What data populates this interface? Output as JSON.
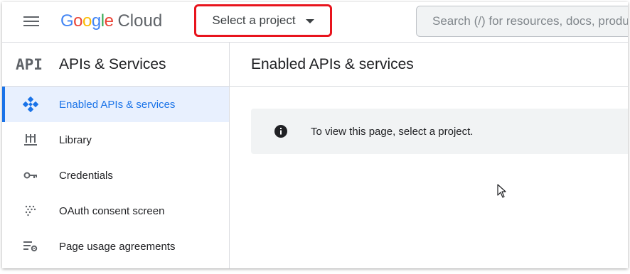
{
  "topbar": {
    "logo_google": [
      "G",
      "o",
      "o",
      "g",
      "l",
      "e"
    ],
    "logo_product": "Cloud",
    "project_picker_label": "Select a project",
    "search_placeholder": "Search (/) for resources, docs, products, and more"
  },
  "sidebar": {
    "section_mark": "API",
    "title": "APIs & Services",
    "items": [
      {
        "label": "Enabled APIs & services",
        "icon": "api-diamond-icon",
        "active": true
      },
      {
        "label": "Library",
        "icon": "library-icon",
        "active": false
      },
      {
        "label": "Credentials",
        "icon": "key-icon",
        "active": false
      },
      {
        "label": "OAuth consent screen",
        "icon": "consent-dots-icon",
        "active": false
      },
      {
        "label": "Page usage agreements",
        "icon": "settings-list-icon",
        "active": false
      }
    ]
  },
  "main": {
    "title": "Enabled APIs & services",
    "notice_text": "To view this page, select a project.",
    "notice_icon": "info-icon"
  },
  "colors": {
    "accent": "#1a73e8",
    "active_bg": "#e8f0fe",
    "highlight_box": "#e8141d",
    "notice_bg": "#f1f3f4"
  }
}
